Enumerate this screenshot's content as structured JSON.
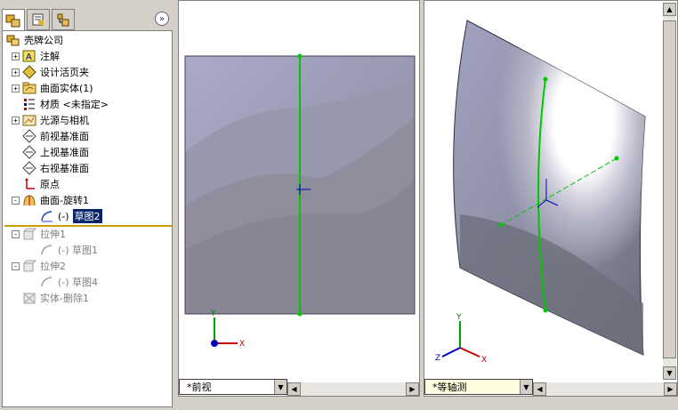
{
  "tree": {
    "root": "壳牌公司",
    "items": [
      {
        "label": "注解",
        "icon": "annotation-icon",
        "expandable": true
      },
      {
        "label": "设计活页夹",
        "icon": "design-binder-icon",
        "expandable": true
      },
      {
        "label": "曲面实体(1)",
        "icon": "surface-bodies-folder-icon",
        "expandable": true
      },
      {
        "label": "材质 <未指定>",
        "icon": "material-icon",
        "expandable": false
      },
      {
        "label": "光源与相机",
        "icon": "lights-cameras-icon",
        "expandable": true
      },
      {
        "label": "前视基准面",
        "icon": "plane-icon",
        "expandable": false
      },
      {
        "label": "上视基准面",
        "icon": "plane-icon",
        "expandable": false
      },
      {
        "label": "右视基准面",
        "icon": "plane-icon",
        "expandable": false
      },
      {
        "label": "原点",
        "icon": "origin-icon",
        "expandable": false
      },
      {
        "label": "曲面-旋转1",
        "icon": "surface-revolve-icon",
        "expandable": true
      }
    ],
    "sketch_child": {
      "prefix": "(-)",
      "label": "草图2"
    },
    "rolled_back": [
      {
        "label": "拉伸1",
        "child": "(-) 草图1"
      },
      {
        "label": "拉伸2",
        "child": "(-) 草图4"
      },
      {
        "label": "实体-删除1",
        "child": null
      }
    ]
  },
  "viewports": {
    "left": {
      "view_name": "*前视"
    },
    "right": {
      "view_name": "*等轴测"
    }
  },
  "triad": {
    "x": "X",
    "y": "Y",
    "z": "Z"
  },
  "colors": {
    "accent": "#00c800",
    "selection": "#0a246a",
    "rollback_bar": "#c8a000"
  }
}
